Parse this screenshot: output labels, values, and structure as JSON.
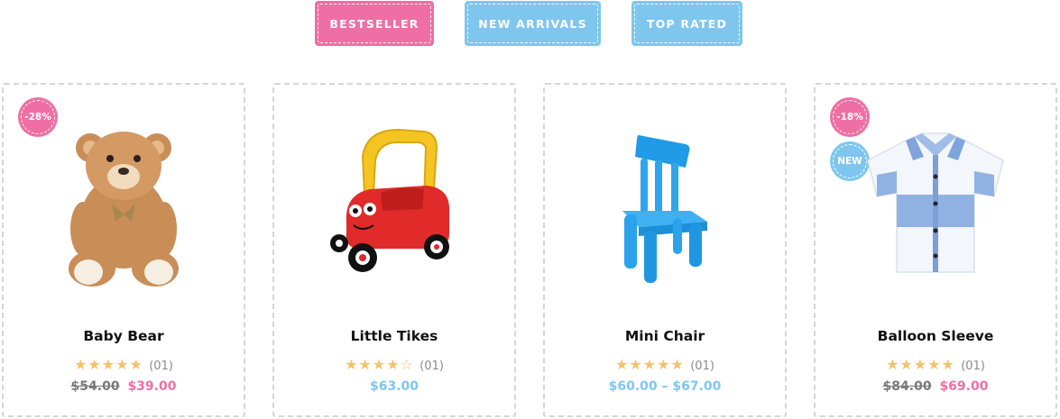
{
  "tabs": [
    {
      "label": "BESTSELLER",
      "color": "#ef6fa4"
    },
    {
      "label": "NEW ARRIVALS",
      "color": "#7fc6ef"
    },
    {
      "label": "TOP RATED",
      "color": "#7fc6ef"
    }
  ],
  "products": [
    {
      "name": "Baby Bear",
      "badges": [
        "-28%"
      ],
      "stars": "★★★★★",
      "rating": 5,
      "reviews": "(01)",
      "old_price": "$54.00",
      "price": "$39.00",
      "icon": "teddy-bear"
    },
    {
      "name": "Little Tikes",
      "badges": [],
      "stars": "★★★★☆",
      "rating": 4,
      "reviews": "(01)",
      "old_price": "",
      "price": "$63.00",
      "icon": "toy-car"
    },
    {
      "name": "Mini Chair",
      "badges": [],
      "stars": "★★★★★",
      "rating": 5,
      "reviews": "(01)",
      "old_price": "",
      "price": "$60.00 – $67.00",
      "icon": "chair"
    },
    {
      "name": "Balloon Sleeve",
      "badges": [
        "-18%",
        "NEW"
      ],
      "stars": "★★★★★",
      "rating": 5,
      "reviews": "(01)",
      "old_price": "$84.00",
      "price": "$69.00",
      "icon": "shirt"
    }
  ],
  "colors": {
    "pink": "#ef6fa4",
    "blue": "#7fc6ef",
    "star": "#f5c26b"
  }
}
